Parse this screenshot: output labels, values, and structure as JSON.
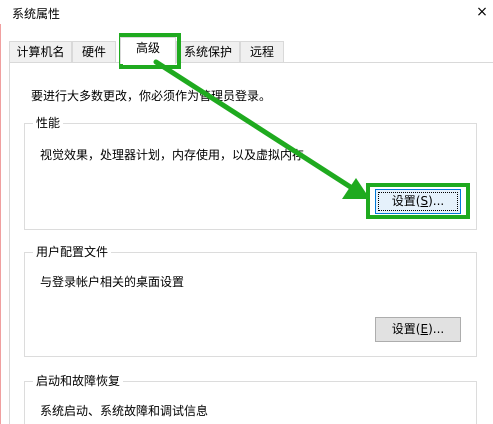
{
  "window": {
    "title": "系统属性",
    "close_glyph": "×"
  },
  "tabs": [
    {
      "label": "计算机名"
    },
    {
      "label": "硬件"
    },
    {
      "label": "高级"
    },
    {
      "label": "系统保护"
    },
    {
      "label": "远程"
    }
  ],
  "active_tab": "高级",
  "advanced": {
    "admin_note": "要进行大多数更改，你必须作为管理员登录。",
    "performance": {
      "title": "性能",
      "description": "视觉效果，处理器计划，内存使用，以及虚拟内存",
      "button_label": "设置(",
      "button_key": "S",
      "button_suffix": ")..."
    },
    "user_profiles": {
      "title": "用户配置文件",
      "description": "与登录帐户相关的桌面设置",
      "button_label": "设置(",
      "button_key": "E",
      "button_suffix": ")..."
    },
    "startup_recovery": {
      "title": "启动和故障恢复",
      "description": "系统启动、系统故障和调试信息"
    }
  },
  "annotation": {
    "highlight_color": "#1faa1f"
  }
}
